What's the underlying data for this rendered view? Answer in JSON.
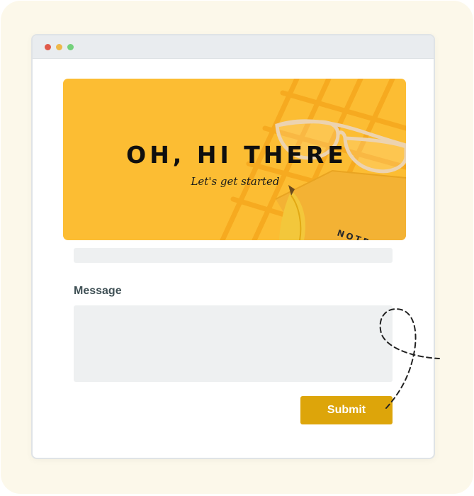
{
  "window": {
    "controls": [
      "close-dot",
      "minimize-dot",
      "maximize-dot"
    ],
    "colors": {
      "close": "#e05a4a",
      "minimize": "#eeb84a",
      "maximize": "#74d17c"
    }
  },
  "hero": {
    "title": "OH, HI THERE",
    "subtitle": "Let's get started",
    "background_color": "#fcbd33",
    "notebook_text": "NOTE"
  },
  "form": {
    "message_label": "Message",
    "message_value": "",
    "submit_label": "Submit",
    "accent_color": "#dda50a"
  }
}
